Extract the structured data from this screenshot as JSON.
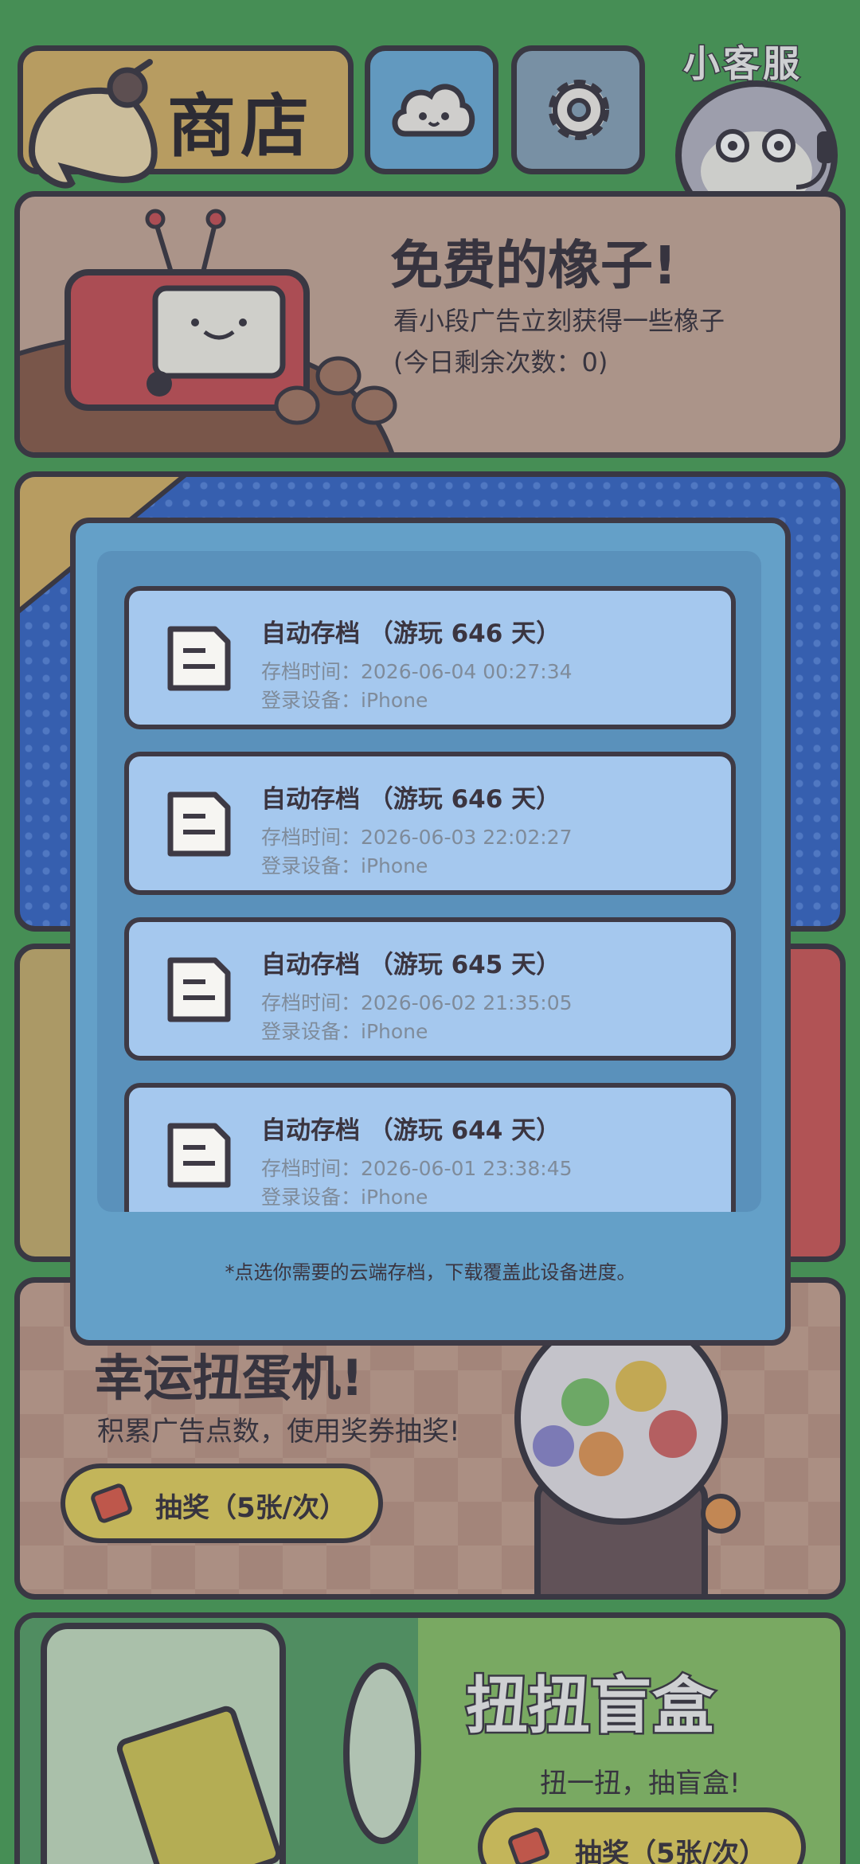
{
  "header": {
    "shop_label": "商店",
    "customer_service_label": "小客服"
  },
  "free_card": {
    "title": "免费的橡子!",
    "subtitle": "看小段广告立刻获得一些橡子",
    "remaining": "(今日剩余次数：0)"
  },
  "gacha_card": {
    "title": "幸运扭蛋机!",
    "subtitle": "积累广告点数，使用奖券抽奖!",
    "button_label": "抽奖（5张/次）"
  },
  "blindbox_card": {
    "title": "扭扭盲盒",
    "subtitle": "扭一扭，抽盲盒!",
    "button_label": "抽奖（5张/次）"
  },
  "modal": {
    "saves": [
      {
        "title": "自动存档 （游玩 646 天）",
        "time": "存档时间：2026-06-04 00:27:34",
        "device": "登录设备：iPhone"
      },
      {
        "title": "自动存档 （游玩 646 天）",
        "time": "存档时间：2026-06-03 22:02:27",
        "device": "登录设备：iPhone"
      },
      {
        "title": "自动存档 （游玩 645 天）",
        "time": "存档时间：2026-06-02 21:35:05",
        "device": "登录设备：iPhone"
      },
      {
        "title": "自动存档 （游玩 644 天）",
        "time": "存档时间：2026-06-01 23:38:45",
        "device": "登录设备：iPhone"
      }
    ],
    "note": "*点选你需要的云端存档，下载覆盖此设备进度。"
  },
  "icons": {
    "back": "back-arrow-icon",
    "cloud": "cloud-icon",
    "settings": "gear-icon",
    "save": "save-file-icon",
    "ticket": "ticket-icon"
  },
  "colors": {
    "background": "#4ea35b",
    "modal": "#64a0c8",
    "save_card": "#a5c8ee",
    "button": "#e6d261"
  }
}
